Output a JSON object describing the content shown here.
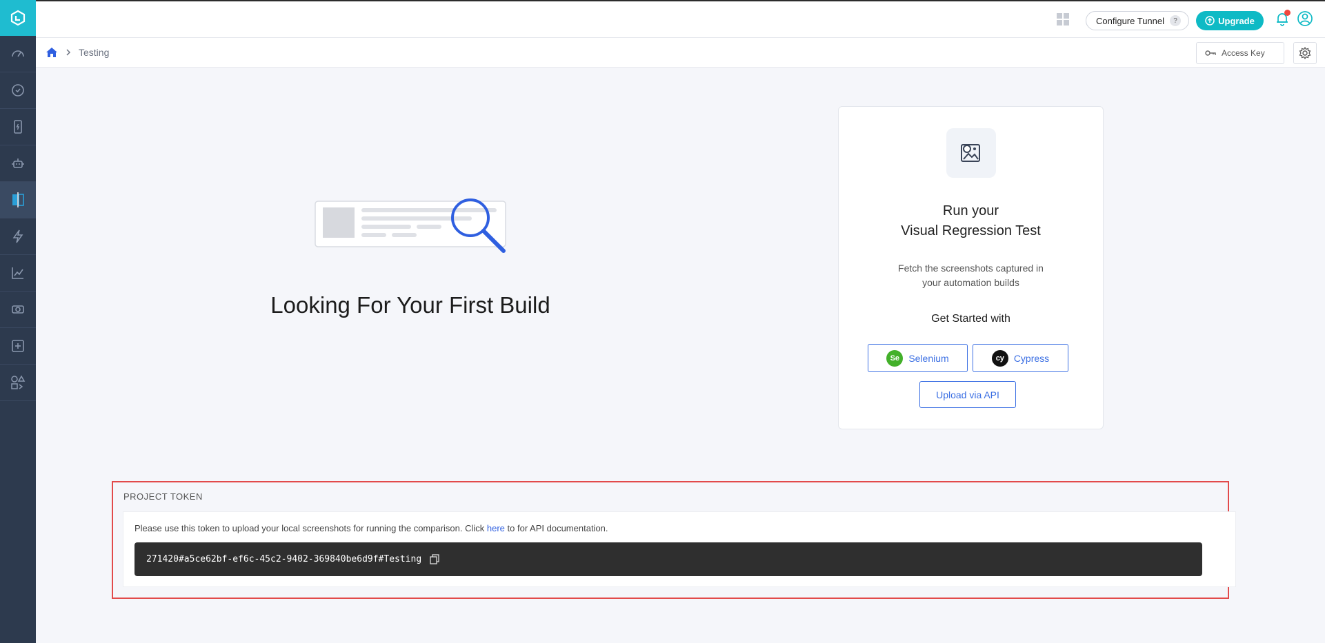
{
  "header": {
    "configure_tunnel": "Configure Tunnel",
    "help_mark": "?",
    "upgrade": "Upgrade",
    "colors": {
      "accent": "#0ebac5",
      "sidebar": "#2d3a4e",
      "link": "#3b6fe3",
      "highlight": "#e24a4a"
    }
  },
  "breadcrumb": {
    "current": "Testing"
  },
  "subbar": {
    "access_key": "Access Key"
  },
  "sidebar": {
    "items": [
      {
        "icon": "speedometer-icon"
      },
      {
        "icon": "clock-icon"
      },
      {
        "icon": "mobile-device-icon"
      },
      {
        "icon": "robot-icon"
      },
      {
        "icon": "visual-compare-icon",
        "active": true
      },
      {
        "icon": "lightning-icon"
      },
      {
        "icon": "analytics-chart-icon"
      },
      {
        "icon": "tickets-icon"
      },
      {
        "icon": "add-box-icon"
      },
      {
        "icon": "integrations-icon"
      }
    ]
  },
  "empty_state": {
    "title": "Looking For Your First Build"
  },
  "card": {
    "title_line1": "Run your",
    "title_line2": "Visual Regression Test",
    "desc_line1": "Fetch the screenshots captured in",
    "desc_line2": "your automation builds",
    "get_started": "Get Started with",
    "selenium": "Selenium",
    "selenium_logo": "Se",
    "cypress": "Cypress",
    "cypress_logo": "cy",
    "upload_api": "Upload via API"
  },
  "token": {
    "label": "PROJECT TOKEN",
    "info_before": "Please use this token to upload your local screenshots for running the comparison. Click ",
    "info_link": "here",
    "info_after": " to for API documentation.",
    "value": "271420#a5ce62bf-ef6c-45c2-9402-369840be6d9f#Testing"
  }
}
